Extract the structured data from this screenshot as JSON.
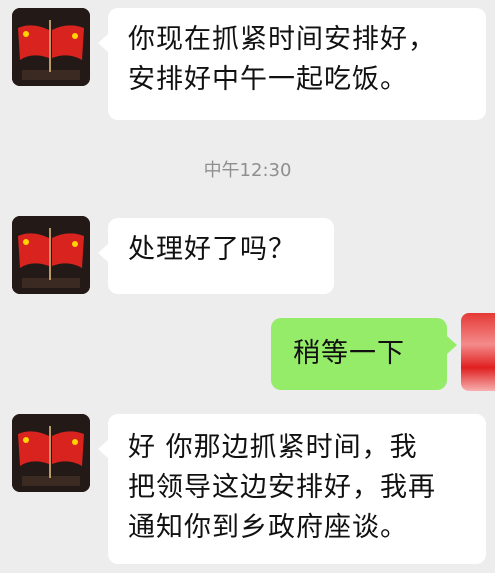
{
  "messages": [
    {
      "side": "incoming",
      "text": "你现在抓紧时间安排好，\n安排好中午一起吃饭。"
    },
    {
      "side": "incoming",
      "text": "处理好了吗？"
    },
    {
      "side": "outgoing",
      "text": "稍等一下"
    },
    {
      "side": "incoming",
      "text": "好 你那边抓紧时间，我\n把领导这边安排好，我再\n通知你到乡政府座谈。"
    }
  ],
  "timestamp": "中午12:30",
  "icons": {
    "contact_avatar": "flags-avatar-icon",
    "self_avatar": "self-avatar-icon"
  },
  "colors": {
    "background": "#ededed",
    "incoming_bubble": "#ffffff",
    "outgoing_bubble": "#95ec69",
    "timestamp_text": "#8f8f8f"
  }
}
